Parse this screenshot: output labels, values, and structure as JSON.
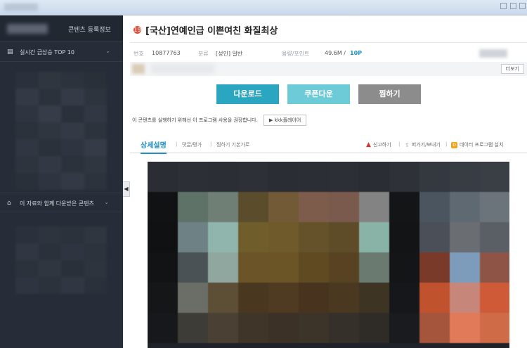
{
  "window": {},
  "sidebar": {
    "header_label": "콘텐츠 등록정보",
    "sections": [
      {
        "icon": "chart-icon",
        "label": "실시간 급상승 TOP 10"
      },
      {
        "icon": "home-icon",
        "label": "이 자료와 함께 다운받은 콘텐츠"
      }
    ],
    "collapse_glyph": "◀",
    "chevron": "⌄"
  },
  "content": {
    "badge": "19",
    "title": "[국산]연예인급 이쁜여친 화질최상",
    "meta": {
      "id_key": "번호",
      "id_value": "10877763",
      "cat_key": "분류",
      "cat_value": "[성인] 일반",
      "size_key": "용량/포인트",
      "size_value": "49.6M /",
      "point_value": "10P"
    },
    "more_label": "더보기",
    "buttons": {
      "download": "다운로드",
      "coupon": "쿠폰다운",
      "bookmark": "찜하기"
    },
    "notice": {
      "text": "이 콘텐츠를 실행하기 위해선 이 프로그램 사용을 권장합니다.",
      "player_label": "kkk플레이어"
    },
    "tabs": {
      "detail": "상세설명",
      "comments": "댓글/평가",
      "guide": "찜하기 기본가로"
    },
    "tools": {
      "report": "신고하기",
      "share": "퍼가기/보내기",
      "install": "데이터 프로그램 설치"
    }
  },
  "colors": {
    "download": "#2aa6c0",
    "coupon": "#6ccbd7",
    "bookmark": "#8c8c8c",
    "accent": "#1f8fc5",
    "sidebar_bg": "#272d38"
  }
}
